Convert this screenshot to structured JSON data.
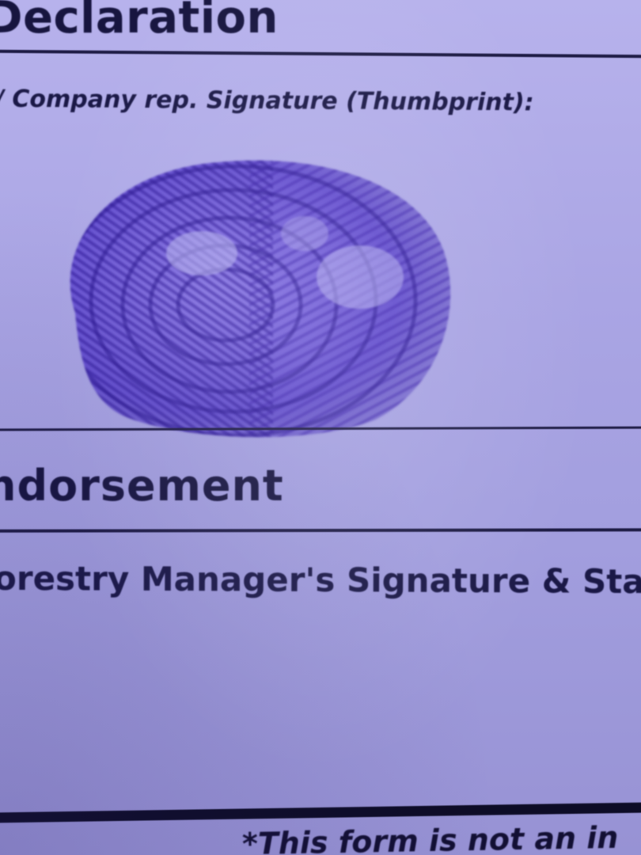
{
  "document": {
    "declaration_heading": "Declaration",
    "thumbprint_label": "/ Company rep. Signature (Thumbprint):",
    "endorsement_heading": "ndorsement",
    "manager_label": "orestry Manager's Signature & Sta",
    "footer_note": "*This form is not an in"
  },
  "colors": {
    "paper": "#aaa5e4",
    "ink": "#17153f",
    "thumbprint_ink": "#4a2ec8"
  }
}
